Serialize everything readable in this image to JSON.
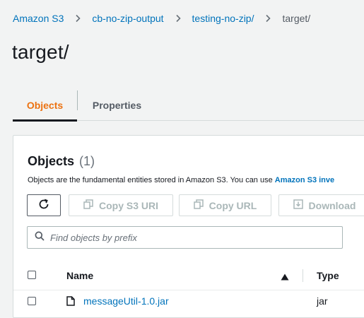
{
  "breadcrumb": {
    "items": [
      "Amazon S3",
      "cb-no-zip-output",
      "testing-no-zip/"
    ],
    "current": "target/"
  },
  "page_title": "target/",
  "tabs": [
    {
      "label": "Objects",
      "active": true
    },
    {
      "label": "Properties",
      "active": false
    }
  ],
  "objects_panel": {
    "title": "Objects",
    "count": "(1)",
    "description": "Objects are the fundamental entities stored in Amazon S3. You can use ",
    "description_link": "Amazon S3 inve",
    "actions": {
      "refresh_icon": "refresh-icon",
      "copy_s3_uri": "Copy S3 URI",
      "copy_url": "Copy URL",
      "download": "Download"
    },
    "search": {
      "placeholder": "Find objects by prefix",
      "value": ""
    },
    "table": {
      "columns": [
        "Name",
        "Type"
      ],
      "sort_column": "Name",
      "sort_direction": "ascending",
      "rows": [
        {
          "name": "messageUtil-1.0.jar",
          "type": "jar",
          "icon": "file-icon"
        }
      ]
    }
  },
  "colors": {
    "background": "#f2f3f3",
    "link": "#0073bb",
    "active_tab": "#ec7211",
    "text": "#16191f",
    "disabled": "#aab7b8"
  }
}
